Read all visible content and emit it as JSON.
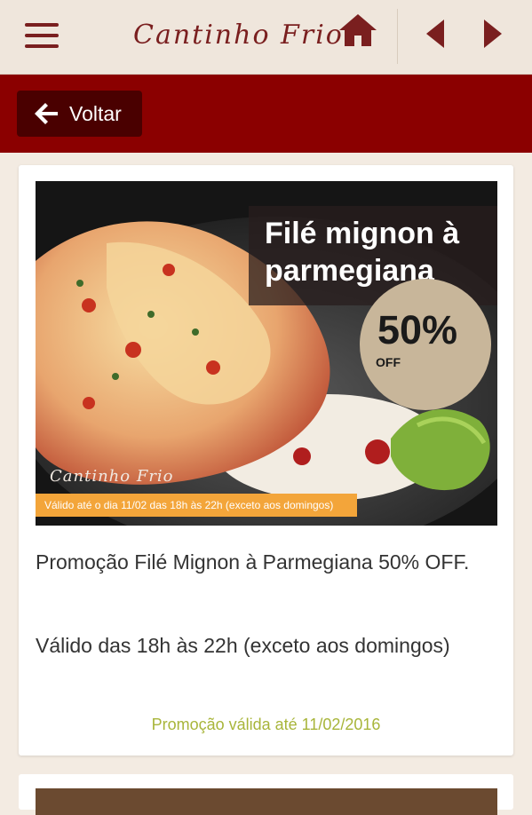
{
  "appbar": {
    "brand": "Cantinho Frio",
    "menu_icon": "menu-icon",
    "prev_icon": "chevron-left-icon",
    "next_icon": "chevron-right-icon",
    "accent_color": "#7a1f1f"
  },
  "nav": {
    "back_label": "Voltar",
    "back_icon": "arrow-left-icon",
    "bar_color": "#8b0000"
  },
  "promo": {
    "image": {
      "title": "Filé mignon à parmegiana",
      "discount": "50%",
      "discount_suffix": "OFF",
      "watermark": "Cantinho Frio",
      "validity_strip": "Válido até o dia 11/02 das 18h às 22h (exceto aos domingos)"
    },
    "description": "Promoção Filé Mignon à Parmegiana 50% OFF.",
    "hours": "Válido das 18h às 22h (exceto aos domingos)",
    "expiry": "Promoção válida até 11/02/2016"
  }
}
